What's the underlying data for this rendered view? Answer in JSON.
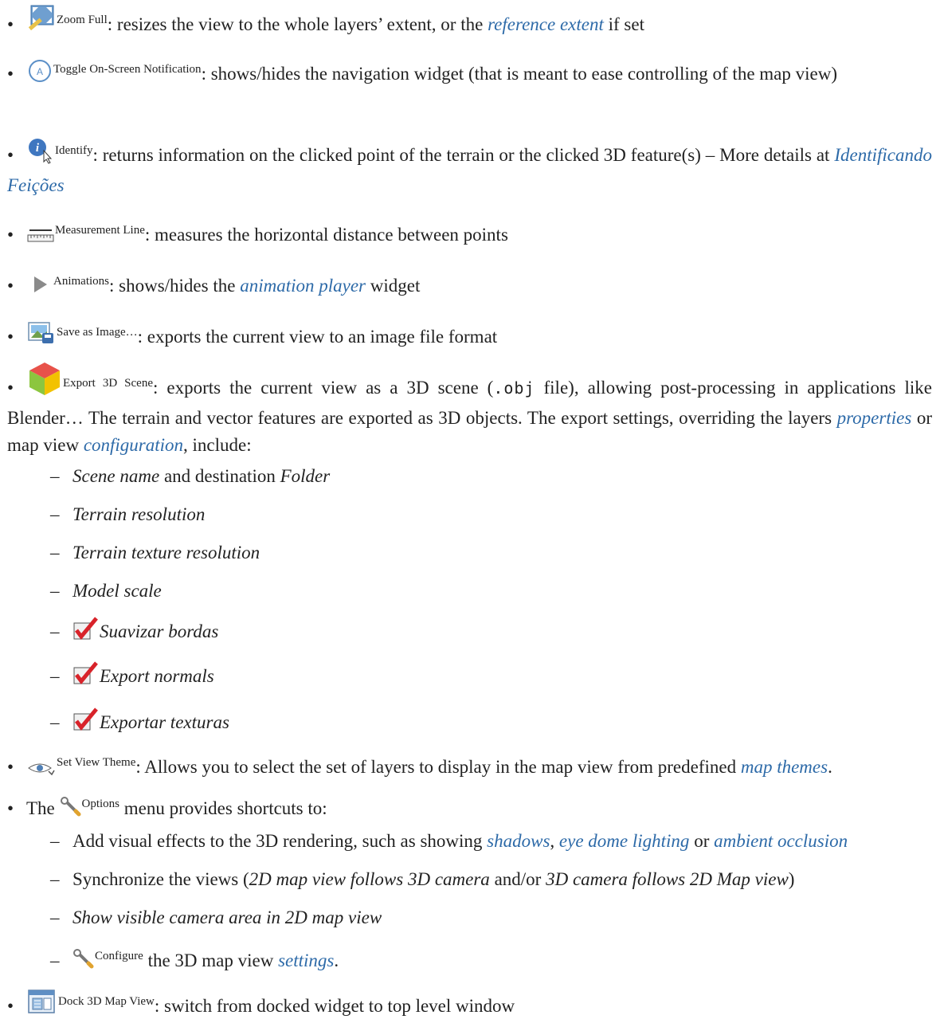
{
  "items": [
    {
      "label": "Zoom Full",
      "pre": ": resizes the view to the whole layers’ extent, or the ",
      "link": "reference extent",
      "post": " if set"
    },
    {
      "label": "Toggle On-Screen Notification",
      "text": ": shows/hides the navigation widget (that is meant to ease controlling of the map view)"
    },
    {
      "label": "Identify",
      "text": ": returns information on the clicked point of the terrain or the clicked 3D feature(s) – More details at ",
      "link": "Identificando Feições"
    },
    {
      "label": "Measurement Line",
      "text": ": measures the horizontal distance between points"
    },
    {
      "label": "Animations",
      "pre": ": shows/hides the ",
      "link": "animation player",
      "post": " widget"
    },
    {
      "label": "Save as Image…",
      "text": ": exports the current view to an image file format"
    },
    {
      "label": "Export 3D Scene",
      "t1": ": exports the current view as a 3D scene (",
      "code": ".obj",
      "t2": " file), allowing post-processing in applications like Blender… The terrain and vector features are exported as 3D objects. The export settings, overriding the layers ",
      "link1": "properties",
      "t3": " or map view ",
      "link2": "configuration",
      "t4": ", include:"
    }
  ],
  "export_sub": {
    "scene_name": "Scene name",
    "and_destination": " and destination ",
    "folder": "Folder",
    "terrain_resolution": "Terrain resolution",
    "terrain_texture_resolution": "Terrain texture resolution",
    "model_scale": "Model scale",
    "smooth_edges": "Suavizar bordas",
    "export_normals": "Export normals",
    "export_textures": "Exportar texturas"
  },
  "view_theme": {
    "label": "Set View Theme",
    "text": ": Allows you to select the set of layers to display in the map view from predefined ",
    "link": "map themes",
    "end": "."
  },
  "options": {
    "pre": "The ",
    "label": "Options",
    "post": " menu provides shortcuts to:",
    "s1_pre": "Add visual effects to the 3D rendering, such as showing ",
    "s1_link1": "shadows",
    "s1_comma": ", ",
    "s1_link2": "eye dome lighting",
    "s1_or": " or ",
    "s1_link3": "ambient occlusion",
    "s2_pre": "Synchronize the views (",
    "s2_em1": "2D map view follows 3D camera",
    "s2_mid": " and/or ",
    "s2_em2": "3D camera follows 2D Map view",
    "s2_end": ")",
    "s3": "Show visible camera area in 2D map view",
    "s4_label": "Configure",
    "s4_pre": " the 3D map view ",
    "s4_link": "settings",
    "s4_end": "."
  },
  "dock": {
    "label": "Dock 3D Map View",
    "text": ": switch from docked widget to top level window"
  },
  "colors": {
    "link": "#2d6aa8",
    "text": "#222222",
    "check": "#d8232a"
  }
}
